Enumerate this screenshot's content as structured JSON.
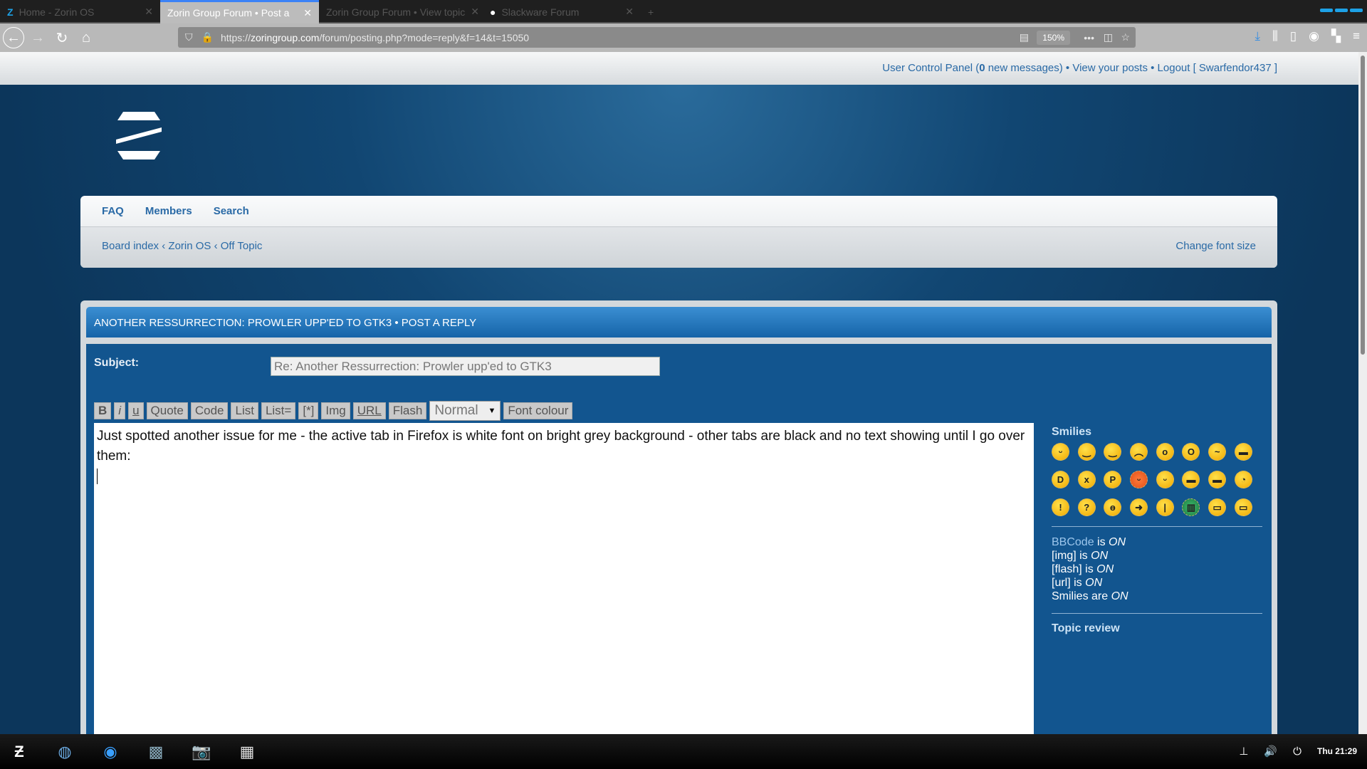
{
  "browser": {
    "tabs": [
      {
        "label": "Home - Zorin OS",
        "active": false
      },
      {
        "label": "Zorin Group Forum • Post a reply",
        "active": true
      },
      {
        "label": "Zorin Group Forum • View topic",
        "active": false
      },
      {
        "label": "Slackware Forum",
        "active": false
      }
    ],
    "url_domain": "zoringroup.com",
    "url_prefix": "https://",
    "url_path": "/forum/posting.php?mode=reply&f=14&t=15050",
    "zoom": "150%",
    "new_tab": "+",
    "close": "✕"
  },
  "userbar": {
    "ucp": "User Control Panel (",
    "new_count": "0",
    "new_msgs": " new messages)",
    "sep": " • ",
    "view_posts": "View your posts",
    "logout": "Logout [ Swarfendor437 ]"
  },
  "nav": {
    "items": [
      "FAQ",
      "Members",
      "Search"
    ],
    "breadcrumb": [
      "Board index",
      "Zorin OS",
      "Off Topic"
    ],
    "crumb_sep": " ‹ ",
    "change_font": "Change font size"
  },
  "post": {
    "title": "ANOTHER RESSURRECTION: PROWLER UPP'ED TO GTK3 • POST A REPLY",
    "subject_label": "Subject:",
    "subject_value": "Re: Another Ressurrection: Prowler upp'ed to GTK3",
    "toolbar": [
      "B",
      "i",
      "u",
      "Quote",
      "Code",
      "List",
      "List=",
      "[*]",
      "Img",
      "URL",
      "Flash"
    ],
    "font_size": "Normal",
    "font_colour": "Font colour",
    "message": "Just spotted another issue for me - the active tab in Firefox is white font on bright grey background - other tabs are black and no text showing until I go over them:"
  },
  "sidebar": {
    "smilies_title": "Smilies",
    "smilies": [
      ":D",
      ":)",
      ";)",
      ":(",
      ":o",
      ":shock:",
      ":?",
      "8-)",
      ":lol:",
      ":x",
      ":P",
      ":oops:",
      ":cry:",
      ":evil:",
      ":twisted:",
      ":roll:",
      ":!:",
      ":?:",
      ":idea:",
      ":arrow:",
      ":|",
      ":mrgreen:",
      ":geek:",
      ":ugeek:"
    ],
    "options": [
      {
        "name": "BBCode",
        "mid": " is ",
        "state": "ON"
      },
      {
        "name": "[img]",
        "mid": " is ",
        "state": "ON"
      },
      {
        "name": "[flash]",
        "mid": " is ",
        "state": "ON"
      },
      {
        "name": "[url]",
        "mid": " is ",
        "state": "ON"
      },
      {
        "name": "Smilies",
        "mid": " are ",
        "state": "ON"
      }
    ],
    "topic_review": "Topic review"
  },
  "taskbar": {
    "apps": [
      "zorin-menu",
      "firefox",
      "web-browser",
      "system-monitor",
      "screenshot",
      "software"
    ],
    "clock": "Thu 21:29"
  }
}
